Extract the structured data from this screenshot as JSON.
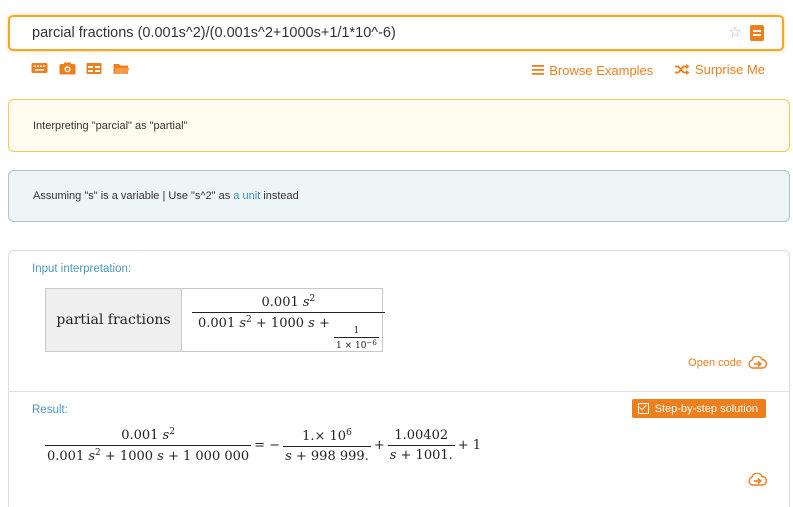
{
  "search": {
    "query": "parcial fractions (0.001s^2)/(0.001s^2+1000s+1/1*10^-6)",
    "star_icon": "star-icon",
    "submit_icon": "equals-icon"
  },
  "toolbar": {
    "icons": [
      "keyboard-icon",
      "camera-icon",
      "table-icon",
      "folder-icon"
    ],
    "browse_examples": "Browse Examples",
    "surprise_me": "Surprise Me"
  },
  "notices": {
    "interpreting": "Interpreting \"parcial\" as \"partial\"",
    "assuming_prefix": "Assuming \"s\" is a variable | Use \"s^2\" as ",
    "assuming_link": "a unit",
    "assuming_suffix": " instead"
  },
  "input_pod": {
    "label": "Input interpretation:",
    "lhs": "partial fractions",
    "num": "0.001",
    "num_var": "s",
    "num_exp": "2",
    "den_a": "0.001",
    "den_var": "s",
    "den_exp": "2",
    "den_plus1": "+ 1000",
    "den_s2": "s",
    "den_plus2": "+",
    "inner_num": "1",
    "inner_den": "1 × 10",
    "inner_exp": "−6",
    "open_code": "Open code"
  },
  "result_pod": {
    "label": "Result:",
    "step_by_step": "Step-by-step solution",
    "lhs_num": "0.001",
    "lhs_num_var": "s",
    "lhs_num_exp": "2",
    "lhs_den_a": "0.001",
    "lhs_den_var": "s",
    "lhs_den_exp": "2",
    "lhs_den_rest_a": "+ 1000",
    "lhs_den_rest_var": "s",
    "lhs_den_rest_b": "+ 1 000 000",
    "eq": "= −",
    "t1_num": "1.× 10",
    "t1_exp": "6",
    "t1_den_var": "s",
    "t1_den_rest": "+ 998 999.",
    "plus": "+",
    "t2_num": "1.00402",
    "t2_den_var": "s",
    "t2_den_rest": "+ 1001.",
    "tail": "+ 1"
  },
  "colors": {
    "accent": "#ef7e1c",
    "search_border": "#f5a623",
    "pod_label": "#4e97bd",
    "link": "#3c8fc4"
  }
}
